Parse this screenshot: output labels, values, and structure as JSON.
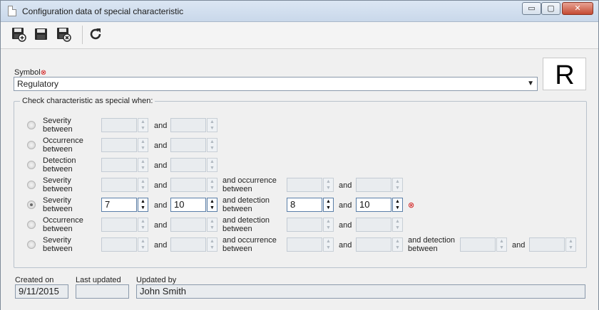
{
  "window": {
    "title": "Configuration data of special characteristic",
    "controls": {
      "minimize": "▭",
      "maximize": "▢",
      "close": "✕"
    }
  },
  "toolbar": {
    "buttons": [
      {
        "name": "save-new-icon"
      },
      {
        "name": "save-icon"
      },
      {
        "name": "save-close-icon"
      },
      {
        "name": "refresh-icon"
      }
    ]
  },
  "symbol": {
    "label": "Symbol",
    "required_mark": "⊗",
    "value": "Regulatory",
    "logo_text": "R"
  },
  "criteria": {
    "legend": "Check characteristic as special when:",
    "and_label": "and",
    "rows": [
      {
        "label1": "Severity",
        "label2": "between",
        "selected": false,
        "v1": "",
        "v2": ""
      },
      {
        "label1": "Occurrence",
        "label2": "between",
        "selected": false,
        "v1": "",
        "v2": ""
      },
      {
        "label1": "Detection",
        "label2": "between",
        "selected": false,
        "v1": "",
        "v2": ""
      },
      {
        "label1": "Severity",
        "label2": "between",
        "selected": false,
        "v1": "",
        "v2": "",
        "mid1": "and occurrence",
        "mid2": "between",
        "v3": "",
        "v4": ""
      },
      {
        "label1": "Severity",
        "label2": "between",
        "selected": true,
        "v1": "7",
        "v2": "10",
        "mid1": "and detection",
        "mid2": "between",
        "v3": "8",
        "v4": "10"
      },
      {
        "label1": "Occurrence",
        "label2": "between",
        "selected": false,
        "v1": "",
        "v2": "",
        "mid1": "and detection",
        "mid2": "between",
        "v3": "",
        "v4": ""
      },
      {
        "label1": "Severity",
        "label2": "between",
        "selected": false,
        "v1": "",
        "v2": "",
        "mid1": "and occurrence",
        "mid2": "between",
        "v3": "",
        "v4": "",
        "mid3": "and detection",
        "mid4": "between",
        "v5": "",
        "v6": ""
      }
    ]
  },
  "footer": {
    "created_label": "Created on",
    "created_value": "9/11/2015",
    "updated_label": "Last updated",
    "updated_value": "",
    "updated_by_label": "Updated by",
    "updated_by_value": "John Smith"
  }
}
